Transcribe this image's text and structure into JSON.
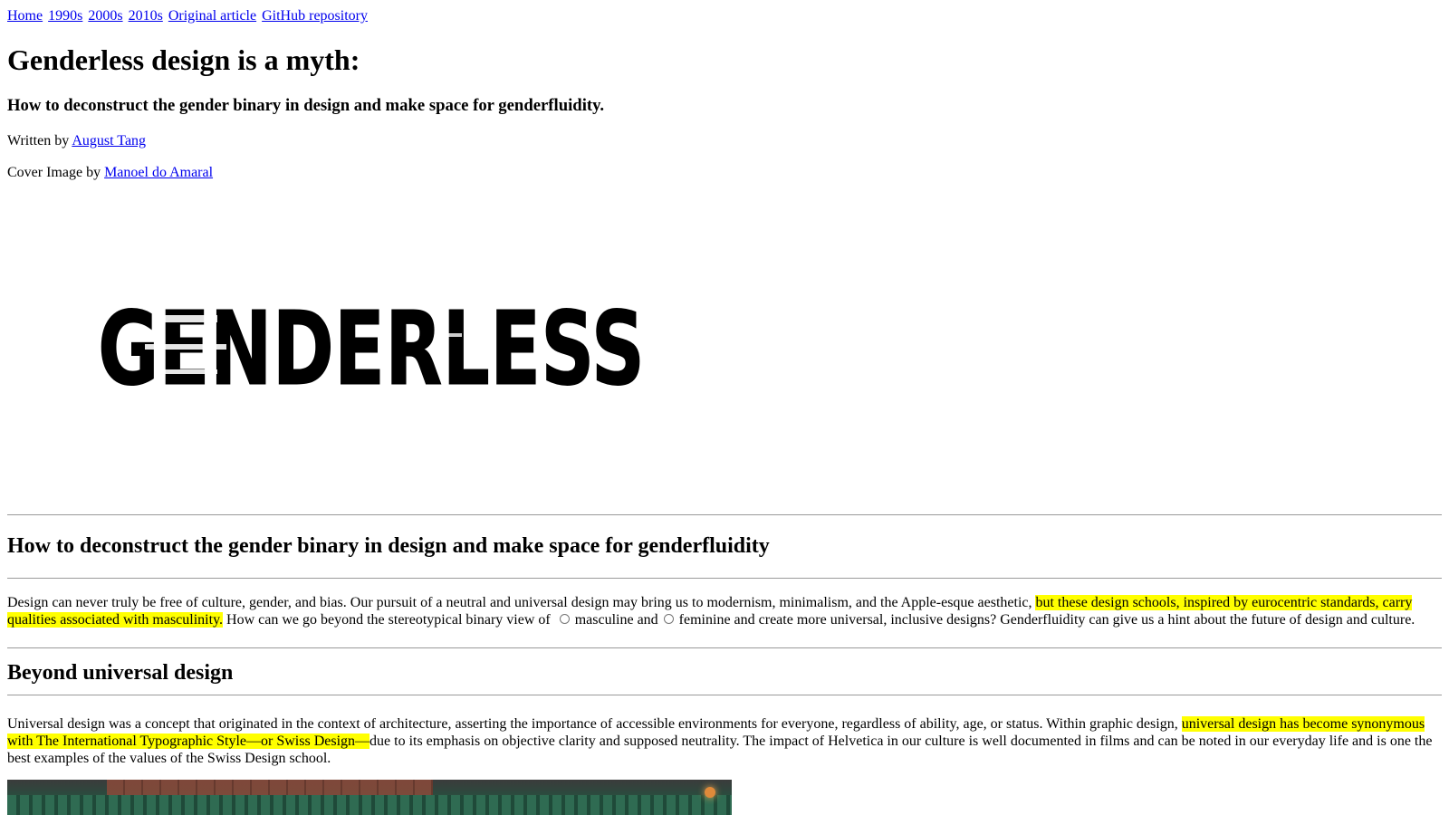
{
  "nav": {
    "links": [
      "Home",
      "1990s",
      "2000s",
      "2010s",
      "Original article",
      "GitHub repository"
    ]
  },
  "article": {
    "title": "Genderless design is a myth:",
    "subtitle": "How to deconstruct the gender binary in design and make space for genderfluidity.",
    "written_by_label": "Written by",
    "author": "August Tang",
    "cover_label": "Cover Image by",
    "cover_author": "Manoel do Amaral",
    "cover_word": "GENDERLESS"
  },
  "section1": {
    "heading": "How to deconstruct the gender binary in design and make space for genderfluidity",
    "p_start": "Design can never truly be free of culture, gender, and bias. Our pursuit of a neutral and universal design may bring us to modernism, minimalism, and the Apple-esque aesthetic, ",
    "p_highlight": "but these design schools, inspired by eurocentric standards, carry qualities associated with masculinity.",
    "p_mid": " How can we go beyond the stereotypical binary view of ",
    "masculine": "masculine and",
    "p_end": "feminine and create more universal, inclusive designs? Genderfluidity can give us a hint about the future of design and culture."
  },
  "section2": {
    "heading": "Beyond universal design",
    "p_start": "Universal design was a concept that originated in the context of architecture, asserting the importance of accessible environments for everyone, regardless of ability, age, or status. Within graphic design, ",
    "p_highlight": "universal design has become synonymous with The International Typographic Style—or Swiss Design—",
    "p_end": "due to its emphasis on objective clarity and supposed neutrality. The impact of Helvetica in our culture is well documented in films and can be noted in our everyday life and is one the best examples of the values of the Swiss Design school."
  }
}
